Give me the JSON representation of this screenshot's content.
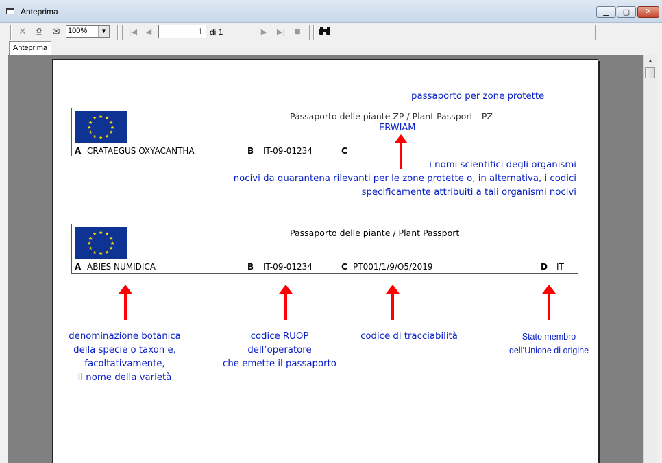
{
  "window": {
    "title": "Anteprima"
  },
  "toolbar": {
    "zoom_value": "100%",
    "current_page": "1",
    "page_of": "di 1"
  },
  "tab": {
    "label": "Anteprima"
  },
  "document": {
    "top_caption": "passaporto per zone protette",
    "zp_card": {
      "header": "Passaporto delle piante ZP / Plant Passport - PZ",
      "organism_code": "ERWIAM",
      "label_a": "A",
      "value_a": "CRATAEGUS OXYACANTHA",
      "label_b": "B",
      "value_b": "IT-09-01234",
      "label_c": "C"
    },
    "zp_note": [
      "i nomi scientifici degli organismi",
      "nocivi da quarantena rilevanti per le zone protette o, in alternativa, i codici",
      "specificamente attribuiti a tali organismi nocivi"
    ],
    "std_card": {
      "header": "Passaporto delle piante / Plant Passport",
      "label_a": "A",
      "value_a": "ABIES NUMIDICA",
      "label_b": "B",
      "value_b": "IT-09-01234",
      "label_c": "C",
      "value_c": "PT001/1/9/O5/2019",
      "label_d": "D",
      "value_d": "IT"
    },
    "explanations": {
      "a": [
        "denominazione botanica",
        "della specie o taxon e,",
        "facoltativamente,",
        "il nome della varietà"
      ],
      "b": [
        "codice RUOP",
        "dell’operatore",
        "che emette il passaporto"
      ],
      "c": [
        "codice di tracciabilità"
      ],
      "d": [
        "Stato membro",
        "dell’Unione di origine"
      ]
    }
  },
  "colors": {
    "annotation_blue": "#0a21c8",
    "arrow_red": "#ff0000",
    "eu_blue": "#0f3392",
    "eu_star": "#ffdd00"
  },
  "icons": [
    "window-icon",
    "close-icon",
    "print-icon",
    "export-icon",
    "first-page-icon",
    "prev-page-icon",
    "next-page-icon",
    "last-page-icon",
    "stop-icon",
    "binoculars-icon"
  ]
}
